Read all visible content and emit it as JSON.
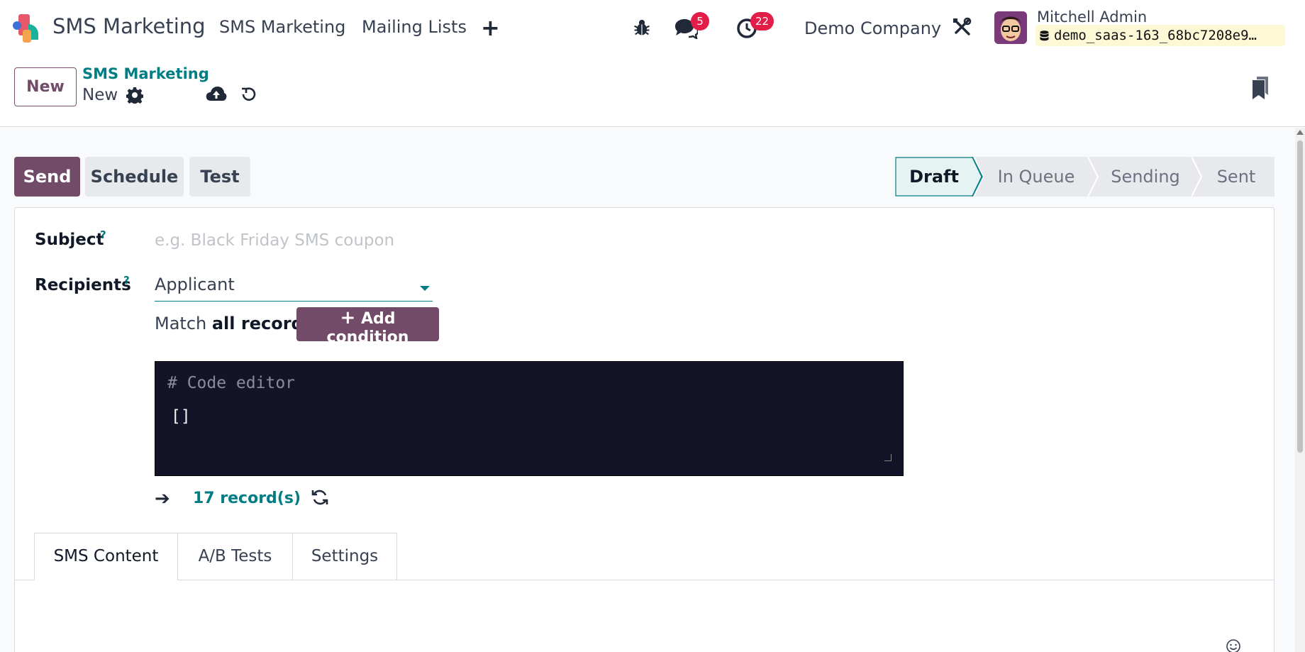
{
  "navbar": {
    "app_name": "SMS Marketing",
    "menu": [
      "SMS Marketing",
      "Mailing Lists"
    ],
    "plus_label": "+",
    "messages_badge": "5",
    "activities_badge": "22",
    "company": "Demo Company",
    "user_name": "Mitchell Admin",
    "database": "demo_saas-163_68bc7208e9…"
  },
  "control": {
    "new_label": "New",
    "breadcrumb_parent": "SMS Marketing",
    "breadcrumb_current": "New"
  },
  "actions": {
    "send": "Send",
    "schedule": "Schedule",
    "test": "Test"
  },
  "status_stages": [
    "Draft",
    "In Queue",
    "Sending",
    "Sent"
  ],
  "active_stage": "Draft",
  "form": {
    "subject_label": "Subject",
    "subject_placeholder": "e.g. Black Friday SMS coupon",
    "help_mark": "?",
    "recipients_label": "Recipients",
    "recipients_value": "Applicant",
    "match_prefix": "Match ",
    "match_bold": "all records",
    "add_condition": "Add condition",
    "code_comment": "# Code editor",
    "code_value": "[]",
    "records_count": "17 record(s)"
  },
  "tabs": [
    "SMS Content",
    "A/B Tests",
    "Settings"
  ],
  "colors": {
    "primary": "#714b67",
    "teal": "#017e84",
    "badge": "#e11d48",
    "code_bg": "#141428"
  }
}
